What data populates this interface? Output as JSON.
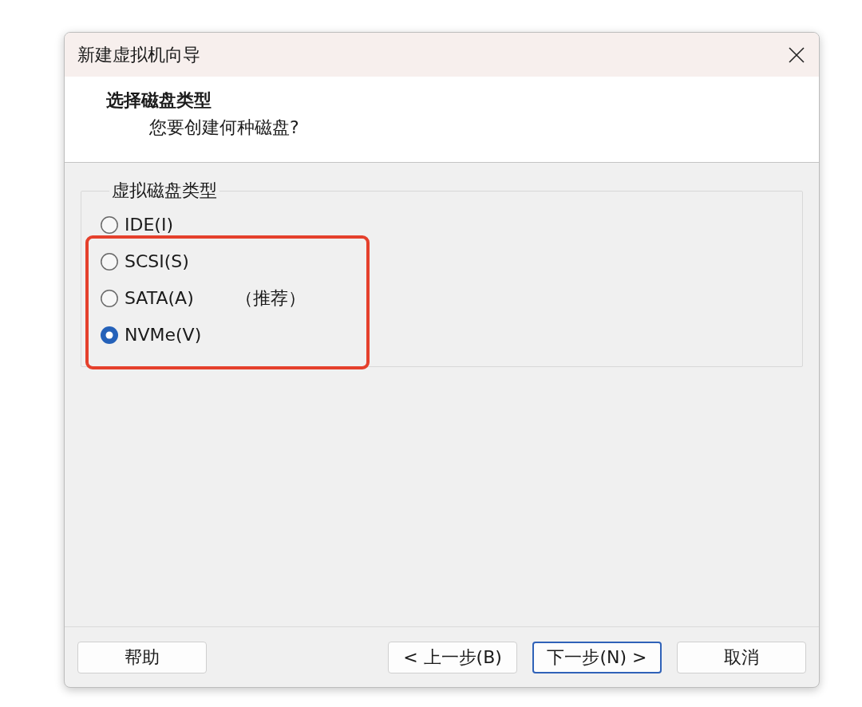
{
  "window": {
    "title": "新建虚拟机向导"
  },
  "header": {
    "title": "选择磁盘类型",
    "subtitle": "您要创建何种磁盘?"
  },
  "disk_type_group": {
    "legend": "虚拟磁盘类型",
    "options": [
      {
        "label": "IDE(I)",
        "selected": false,
        "highlighted": false
      },
      {
        "label": "SCSI(S)",
        "selected": false,
        "highlighted": true
      },
      {
        "label": "SATA(A)",
        "note": "（推荐）",
        "selected": false,
        "highlighted": true
      },
      {
        "label": "NVMe(V)",
        "selected": true,
        "highlighted": true
      }
    ]
  },
  "footer": {
    "help_button": {
      "label": "帮助"
    },
    "buttons": [
      {
        "label": "< 上一步(B)",
        "default": false
      },
      {
        "label": "下一步(N) >",
        "default": true
      },
      {
        "label": "取消",
        "default": false
      }
    ]
  }
}
